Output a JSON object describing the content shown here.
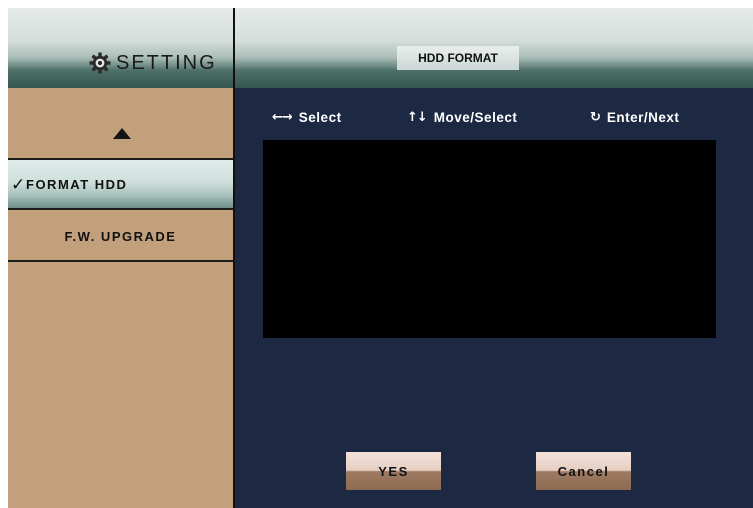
{
  "sidebar": {
    "title": "SETTING",
    "items": [
      {
        "label": "FORMAT HDD",
        "selected": true,
        "check": "✓"
      },
      {
        "label": "F.W. UPGRADE",
        "selected": false
      }
    ]
  },
  "main": {
    "title": "HDD FORMAT",
    "hints": [
      {
        "icon": "left-right-arrows-icon",
        "glyph": "←→",
        "label": "Select"
      },
      {
        "icon": "up-down-arrows-icon",
        "glyph": "↑↓",
        "label": "Move/Select"
      },
      {
        "icon": "enter-return-icon",
        "glyph": "↻",
        "label": "Enter/Next"
      }
    ]
  },
  "buttons": {
    "yes_label": "YES",
    "cancel_label": "Cancel"
  },
  "colors": {
    "panel_left": "#c1a07b",
    "panel_right": "#1d2942",
    "content_box": "#000000",
    "selected_item": "#cfe0dc"
  }
}
